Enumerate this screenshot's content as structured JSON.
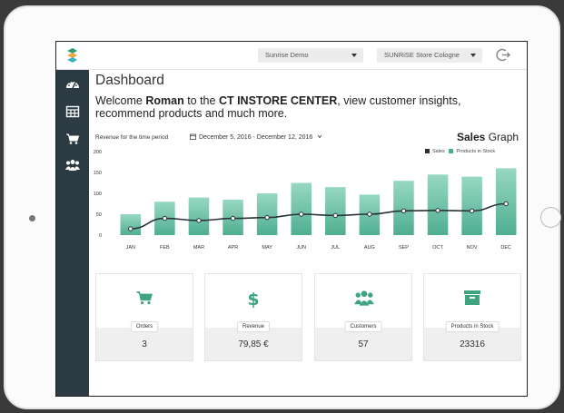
{
  "topbar": {
    "project_select": "Sunrise Demo",
    "store_select": "SUNRiSE Store Cologne"
  },
  "sidebar": {
    "items": [
      {
        "icon": "dashboard-icon"
      },
      {
        "icon": "table-icon"
      },
      {
        "icon": "cart-icon"
      },
      {
        "icon": "users-icon"
      }
    ]
  },
  "main": {
    "title": "Dashboard",
    "welcome_prefix": "Welcome ",
    "welcome_user": "Roman",
    "welcome_middle": " to the ",
    "welcome_center": "CT INSTORE CENTER",
    "welcome_suffix": ", view customer insights, recommend products and much more.",
    "revenue_label": "Revenue for the time period",
    "date_range": "December 5, 2016 - December 12, 2016"
  },
  "chart_heading": {
    "bold": "Sales",
    "rest": "Graph"
  },
  "colors": {
    "bar_top": "#8ed3bc",
    "bar_bottom": "#4fae90",
    "line": "#2a3238",
    "accent": "#3fa57f",
    "sidebar": "#2b3a43"
  },
  "chart_data": {
    "type": "bar",
    "categories": [
      "JAN",
      "FEB",
      "MAR",
      "APR",
      "MAY",
      "JUN",
      "JUL",
      "AUG",
      "SEP",
      "OCT",
      "NOV",
      "DEC"
    ],
    "series": [
      {
        "name": "Sales",
        "type": "line",
        "values": [
          15,
          40,
          35,
          40,
          42,
          50,
          47,
          50,
          58,
          59,
          58,
          75
        ]
      },
      {
        "name": "Products in Stock",
        "type": "bar",
        "values": [
          50,
          80,
          90,
          85,
          100,
          125,
          115,
          97,
          130,
          145,
          140,
          160
        ]
      }
    ],
    "yticks": [
      0,
      50,
      100,
      150,
      200
    ],
    "ylim": [
      0,
      200
    ],
    "legend_position": "top-right"
  },
  "cards": [
    {
      "icon": "cart-icon",
      "label": "Orders",
      "value": "3"
    },
    {
      "icon": "dollar-icon",
      "label": "Revenue",
      "value": "79,85 €"
    },
    {
      "icon": "users-icon",
      "label": "Customers",
      "value": "57"
    },
    {
      "icon": "archive-icon",
      "label": "Products in Stock",
      "value": "23316"
    }
  ]
}
